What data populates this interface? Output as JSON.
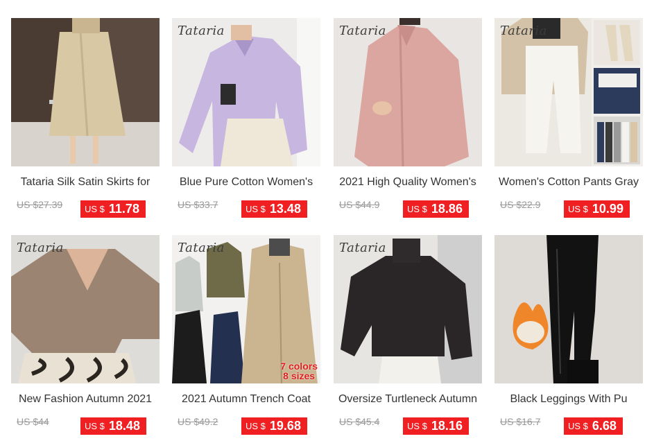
{
  "products": [
    {
      "brand": "",
      "title": "Tataria Silk Satin Skirts for",
      "original_price": "US $27.39",
      "currency": "US $",
      "price": "11.78"
    },
    {
      "brand": "Tataria",
      "title": "Blue Pure Cotton Women's",
      "original_price": "US $33.7",
      "currency": "US $",
      "price": "13.48"
    },
    {
      "brand": "Tataria",
      "title": "2021 High Quality Women's",
      "original_price": "US $44.9",
      "currency": "US $",
      "price": "18.86"
    },
    {
      "brand": "Tataria",
      "title": "Women's Cotton Pants Gray",
      "original_price": "US $22.9",
      "currency": "US $",
      "price": "10.99"
    },
    {
      "brand": "Tataria",
      "title": "New Fashion Autumn 2021",
      "original_price": "US $44",
      "currency": "US $",
      "price": "18.48"
    },
    {
      "brand": "Tataria",
      "title": "2021 Autumn Trench Coat",
      "original_price": "US $49.2",
      "currency": "US $",
      "price": "19.68",
      "badge_line1": "7 colors",
      "badge_line2": "8 sizes"
    },
    {
      "brand": "Tataria",
      "title": "Oversize Turtleneck Autumn",
      "original_price": "US $45.4",
      "currency": "US $",
      "price": "18.16"
    },
    {
      "brand": "",
      "title": "Black Leggings With Pu",
      "original_price": "US $16.7",
      "currency": "US $",
      "price": "6.68"
    }
  ],
  "colors": {
    "price_bg": "#ef1f22",
    "title": "#333333",
    "strike": "#999999"
  }
}
